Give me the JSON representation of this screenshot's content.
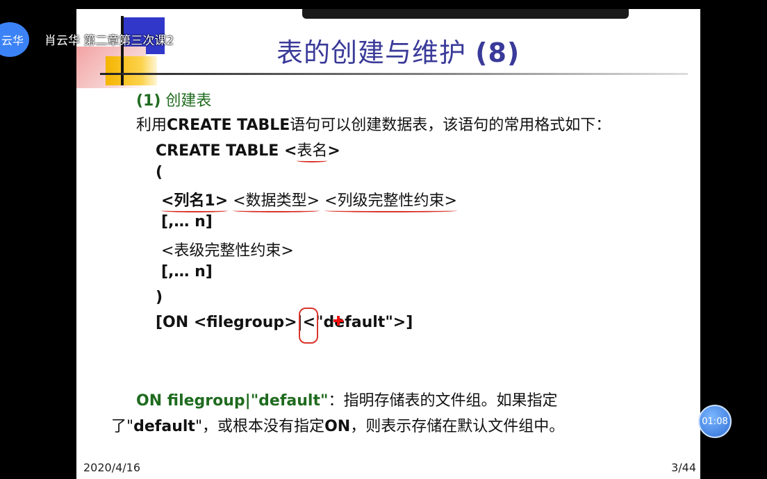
{
  "overlay": {
    "avatar_text": "云华",
    "lecture_title": "肖云华 第二章第三次课2",
    "timer": "01:08"
  },
  "slide": {
    "title_cn": "表的创建与维护",
    "title_num": "(8)",
    "section_num": "(1)",
    "section_label": "创建表",
    "intro_pre": "利用",
    "intro_kw": "CREATE TABLE",
    "intro_post": "语句可以创建数据表，该语句的常用格式如下：",
    "code_kw": "CREATE TABLE",
    "code_table_open": "<",
    "code_table_name": "表名",
    "code_table_close": ">",
    "open_paren": "(",
    "col_name": "<列名1>",
    "data_type": "<数据类型>",
    "col_constraint": "<列级完整性约束>",
    "repeat1": "[,… n]",
    "table_constraint": "<表级完整性约束>",
    "repeat2": "[,… n]",
    "close_paren": ")",
    "on_clause": "[ON <filegroup>|<\"default\">]",
    "note_kw": "ON  filegroup|\"default\"",
    "note_text": "：指明存储表的文件组。如果指定",
    "note2_pre": "了\"",
    "note2_kw": "default",
    "note2_mid": "\"，或根本没有指定",
    "note2_on": "ON",
    "note2_post": "，则表示存储在默认文件组中。",
    "date": "2020/4/16",
    "page": "3/44"
  },
  "colors": {
    "title": "#3a3a9a",
    "green": "#1f6b1f",
    "annotation_red": "#d9342b",
    "timer_blue": "#2f6fd6"
  }
}
